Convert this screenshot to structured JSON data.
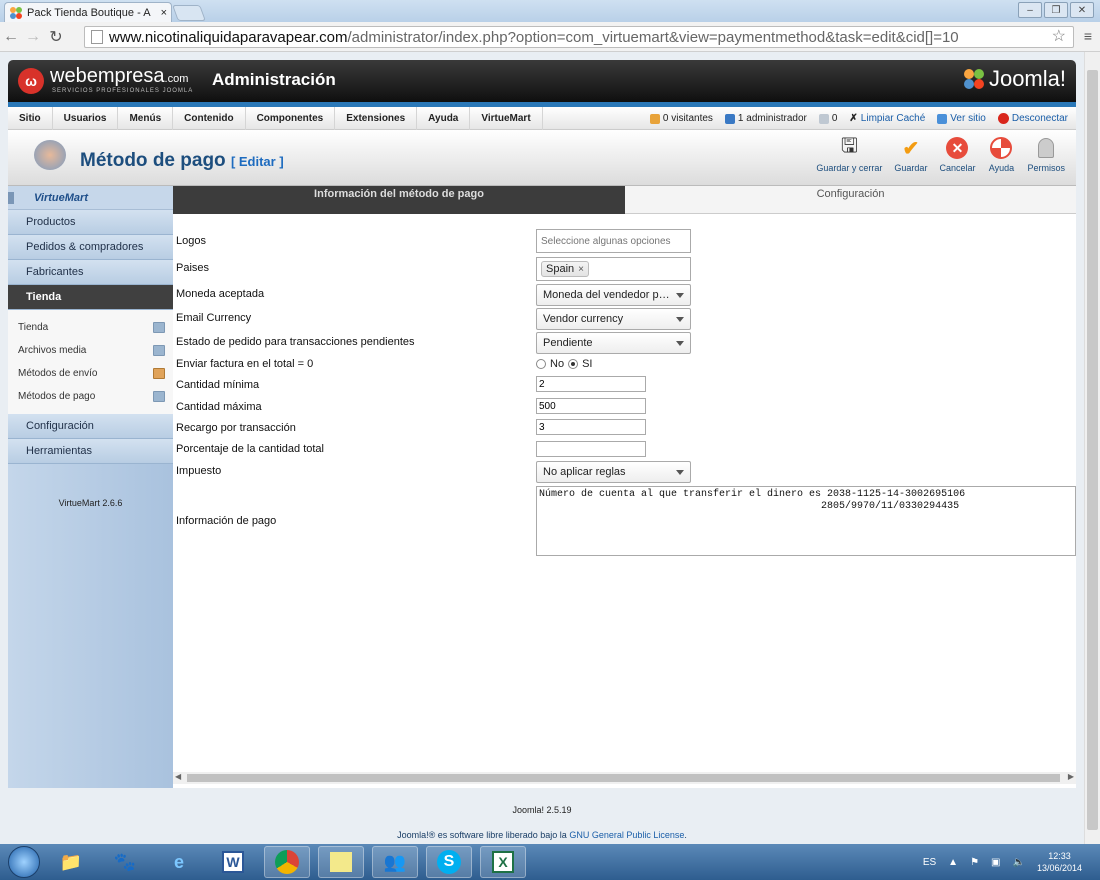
{
  "browser": {
    "tab_title": "Pack Tienda Boutique - A",
    "tab_close": "×",
    "url_host": "www.nicotinaliquidaparavapear.com",
    "url_path": "/administrator/index.php?option=com_virtuemart&view=paymentmethod&task=edit&cid[]=10"
  },
  "header": {
    "brand": "webempresa",
    "brand_suffix": ".com",
    "brand_sub": "SERVICIOS PROFESIONALES JOOMLA",
    "admin": "Administración",
    "joomla": "Joomla!"
  },
  "menu": [
    "Sitio",
    "Usuarios",
    "Menús",
    "Contenido",
    "Componentes",
    "Extensiones",
    "Ayuda",
    "VirtueMart"
  ],
  "status": {
    "visitors": "0 visitantes",
    "admins": "1 administrador",
    "messages": "0",
    "clear_cache": "Limpiar Caché",
    "view_site": "Ver sitio",
    "logout": "Desconectar"
  },
  "title": {
    "text": "Método de pago",
    "edit": "[ Editar ]"
  },
  "toolbar": {
    "save_close": "Guardar y cerrar",
    "save": "Guardar",
    "cancel": "Cancelar",
    "help": "Ayuda",
    "permissions": "Permisos"
  },
  "sidebar": {
    "logo": "VirtueMart",
    "sections_top": [
      "Productos",
      "Pedidos & compradores",
      "Fabricantes"
    ],
    "active": "Tienda",
    "subs": [
      "Tienda",
      "Archivos media",
      "Métodos de envío",
      "Métodos de pago"
    ],
    "sections_bottom": [
      "Configuración",
      "Herramientas"
    ],
    "version": "VirtueMart 2.6.6"
  },
  "tabs": {
    "info": "Información del método de pago",
    "config": "Configuración"
  },
  "form": {
    "logos_label": "Logos",
    "logos_placeholder": "Seleccione algunas opciones",
    "countries_label": "Paises",
    "country_chip": "Spain",
    "chip_remove": "×",
    "currency_label": "Moneda aceptada",
    "currency_value": "Moneda del vendedor p…",
    "email_currency_label": "Email Currency",
    "email_currency_value": "Vendor currency",
    "pending_label": "Estado de pedido para transacciones pendientes",
    "pending_value": "Pendiente",
    "invoice_label": "Enviar factura en el total = 0",
    "no_label": "No",
    "yes_label": "SI",
    "min_label": "Cantidad mínima",
    "min_value": "2",
    "max_label": "Cantidad máxima",
    "max_value": "500",
    "fee_label": "Recargo por transacción",
    "fee_value": "3",
    "pct_label": "Porcentaje de la cantidad total",
    "pct_value": "",
    "tax_label": "Impuesto",
    "tax_value": "No aplicar reglas",
    "payinfo_label": "Información de pago",
    "payinfo_value": "Número de cuenta al que transferir el dinero es 2038-1125-14-3002695106\n                                               2805/9970/11/0330294435"
  },
  "footer": {
    "version": "Joomla! 2.5.19",
    "license_pre": "Joomla!® es software libre liberado bajo la",
    "license_link": "GNU General Public License",
    "license_post": "."
  },
  "taskbar": {
    "lang": "ES",
    "time": "12:33",
    "date": "13/06/2014"
  }
}
